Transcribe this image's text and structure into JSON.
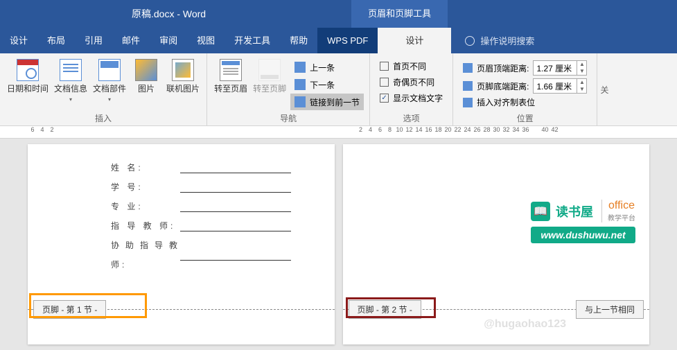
{
  "titlebar": {
    "document": "原稿.docx  -  Word",
    "tool_context": "页眉和页脚工具"
  },
  "tabs": {
    "start": "设计",
    "layout": "布局",
    "ref": "引用",
    "mail": "邮件",
    "review": "审阅",
    "view": "视图",
    "dev": "开发工具",
    "help": "帮助",
    "pdf": "WPS PDF",
    "design": "设计",
    "search": "操作说明搜索"
  },
  "ribbon": {
    "insert": {
      "label": "插入",
      "datetime": "日期和时间",
      "docinfo": "文档信息",
      "parts": "文档部件",
      "pic": "图片",
      "online": "联机图片"
    },
    "nav": {
      "label": "导航",
      "goto_header": "转至页眉",
      "goto_footer": "转至页脚",
      "prev": "上一条",
      "next": "下一条",
      "link_prev": "链接到前一节"
    },
    "options": {
      "label": "选项",
      "first_diff": "首页不同",
      "odd_even": "奇偶页不同",
      "show_text": "显示文档文字"
    },
    "position": {
      "label": "位置",
      "header_top": "页眉顶端距离:",
      "footer_bottom": "页脚底端距离:",
      "align_tab": "插入对齐制表位",
      "header_val": "1.27 厘米",
      "footer_val": "1.66 厘米"
    },
    "close": {
      "label": "关"
    }
  },
  "ruler": {
    "left": [
      "6",
      "4",
      "2"
    ],
    "right": [
      "2",
      "4",
      "6",
      "8",
      "10",
      "12",
      "14",
      "16",
      "18",
      "20",
      "22",
      "24",
      "26",
      "28",
      "30",
      "32",
      "34",
      "36",
      "",
      "40",
      "42"
    ]
  },
  "page1": {
    "fields": {
      "name": "姓        名:",
      "id": "学        号:",
      "major": "专        业:",
      "advisor": "指  导  教  师:",
      "co": "协助指导教师:"
    },
    "footer_tag": "页脚 - 第 1 节 -"
  },
  "page2": {
    "footer_tag": "页脚 - 第 2 节 -",
    "same_as_prev": "与上一节相同",
    "wm_brand": "读书屋",
    "wm_office": "office",
    "wm_sub": "教学平台",
    "wm_url": "www.dushuwu.net",
    "ghost": "@hugaohao123"
  },
  "checks": {
    "first": false,
    "odd": false,
    "show": true
  }
}
